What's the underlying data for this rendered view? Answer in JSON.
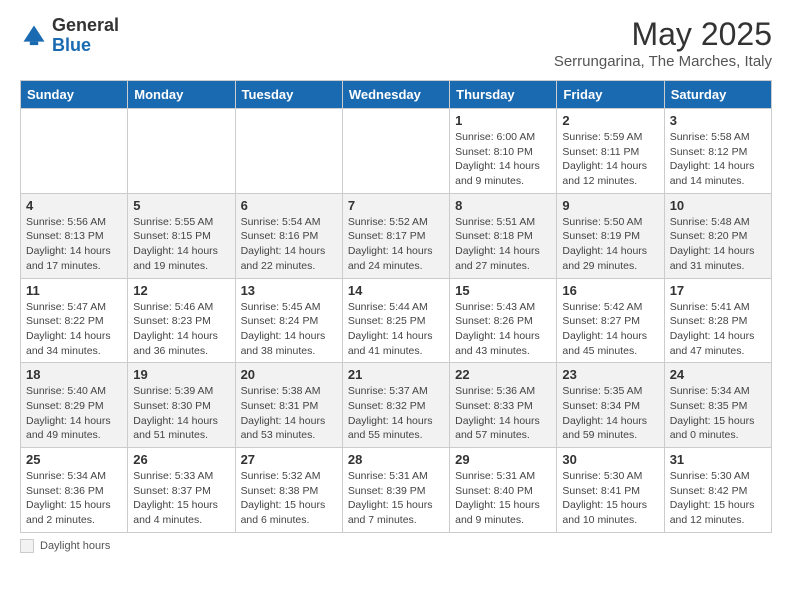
{
  "logo": {
    "general": "General",
    "blue": "Blue"
  },
  "title": "May 2025",
  "subtitle": "Serrungarina, The Marches, Italy",
  "days_of_week": [
    "Sunday",
    "Monday",
    "Tuesday",
    "Wednesday",
    "Thursday",
    "Friday",
    "Saturday"
  ],
  "weeks": [
    [
      {
        "day": "",
        "info": ""
      },
      {
        "day": "",
        "info": ""
      },
      {
        "day": "",
        "info": ""
      },
      {
        "day": "",
        "info": ""
      },
      {
        "day": "1",
        "info": "Sunrise: 6:00 AM\nSunset: 8:10 PM\nDaylight: 14 hours and 9 minutes."
      },
      {
        "day": "2",
        "info": "Sunrise: 5:59 AM\nSunset: 8:11 PM\nDaylight: 14 hours and 12 minutes."
      },
      {
        "day": "3",
        "info": "Sunrise: 5:58 AM\nSunset: 8:12 PM\nDaylight: 14 hours and 14 minutes."
      }
    ],
    [
      {
        "day": "4",
        "info": "Sunrise: 5:56 AM\nSunset: 8:13 PM\nDaylight: 14 hours and 17 minutes."
      },
      {
        "day": "5",
        "info": "Sunrise: 5:55 AM\nSunset: 8:15 PM\nDaylight: 14 hours and 19 minutes."
      },
      {
        "day": "6",
        "info": "Sunrise: 5:54 AM\nSunset: 8:16 PM\nDaylight: 14 hours and 22 minutes."
      },
      {
        "day": "7",
        "info": "Sunrise: 5:52 AM\nSunset: 8:17 PM\nDaylight: 14 hours and 24 minutes."
      },
      {
        "day": "8",
        "info": "Sunrise: 5:51 AM\nSunset: 8:18 PM\nDaylight: 14 hours and 27 minutes."
      },
      {
        "day": "9",
        "info": "Sunrise: 5:50 AM\nSunset: 8:19 PM\nDaylight: 14 hours and 29 minutes."
      },
      {
        "day": "10",
        "info": "Sunrise: 5:48 AM\nSunset: 8:20 PM\nDaylight: 14 hours and 31 minutes."
      }
    ],
    [
      {
        "day": "11",
        "info": "Sunrise: 5:47 AM\nSunset: 8:22 PM\nDaylight: 14 hours and 34 minutes."
      },
      {
        "day": "12",
        "info": "Sunrise: 5:46 AM\nSunset: 8:23 PM\nDaylight: 14 hours and 36 minutes."
      },
      {
        "day": "13",
        "info": "Sunrise: 5:45 AM\nSunset: 8:24 PM\nDaylight: 14 hours and 38 minutes."
      },
      {
        "day": "14",
        "info": "Sunrise: 5:44 AM\nSunset: 8:25 PM\nDaylight: 14 hours and 41 minutes."
      },
      {
        "day": "15",
        "info": "Sunrise: 5:43 AM\nSunset: 8:26 PM\nDaylight: 14 hours and 43 minutes."
      },
      {
        "day": "16",
        "info": "Sunrise: 5:42 AM\nSunset: 8:27 PM\nDaylight: 14 hours and 45 minutes."
      },
      {
        "day": "17",
        "info": "Sunrise: 5:41 AM\nSunset: 8:28 PM\nDaylight: 14 hours and 47 minutes."
      }
    ],
    [
      {
        "day": "18",
        "info": "Sunrise: 5:40 AM\nSunset: 8:29 PM\nDaylight: 14 hours and 49 minutes."
      },
      {
        "day": "19",
        "info": "Sunrise: 5:39 AM\nSunset: 8:30 PM\nDaylight: 14 hours and 51 minutes."
      },
      {
        "day": "20",
        "info": "Sunrise: 5:38 AM\nSunset: 8:31 PM\nDaylight: 14 hours and 53 minutes."
      },
      {
        "day": "21",
        "info": "Sunrise: 5:37 AM\nSunset: 8:32 PM\nDaylight: 14 hours and 55 minutes."
      },
      {
        "day": "22",
        "info": "Sunrise: 5:36 AM\nSunset: 8:33 PM\nDaylight: 14 hours and 57 minutes."
      },
      {
        "day": "23",
        "info": "Sunrise: 5:35 AM\nSunset: 8:34 PM\nDaylight: 14 hours and 59 minutes."
      },
      {
        "day": "24",
        "info": "Sunrise: 5:34 AM\nSunset: 8:35 PM\nDaylight: 15 hours and 0 minutes."
      }
    ],
    [
      {
        "day": "25",
        "info": "Sunrise: 5:34 AM\nSunset: 8:36 PM\nDaylight: 15 hours and 2 minutes."
      },
      {
        "day": "26",
        "info": "Sunrise: 5:33 AM\nSunset: 8:37 PM\nDaylight: 15 hours and 4 minutes."
      },
      {
        "day": "27",
        "info": "Sunrise: 5:32 AM\nSunset: 8:38 PM\nDaylight: 15 hours and 6 minutes."
      },
      {
        "day": "28",
        "info": "Sunrise: 5:31 AM\nSunset: 8:39 PM\nDaylight: 15 hours and 7 minutes."
      },
      {
        "day": "29",
        "info": "Sunrise: 5:31 AM\nSunset: 8:40 PM\nDaylight: 15 hours and 9 minutes."
      },
      {
        "day": "30",
        "info": "Sunrise: 5:30 AM\nSunset: 8:41 PM\nDaylight: 15 hours and 10 minutes."
      },
      {
        "day": "31",
        "info": "Sunrise: 5:30 AM\nSunset: 8:42 PM\nDaylight: 15 hours and 12 minutes."
      }
    ]
  ],
  "footer": {
    "daylight_label": "Daylight hours"
  }
}
